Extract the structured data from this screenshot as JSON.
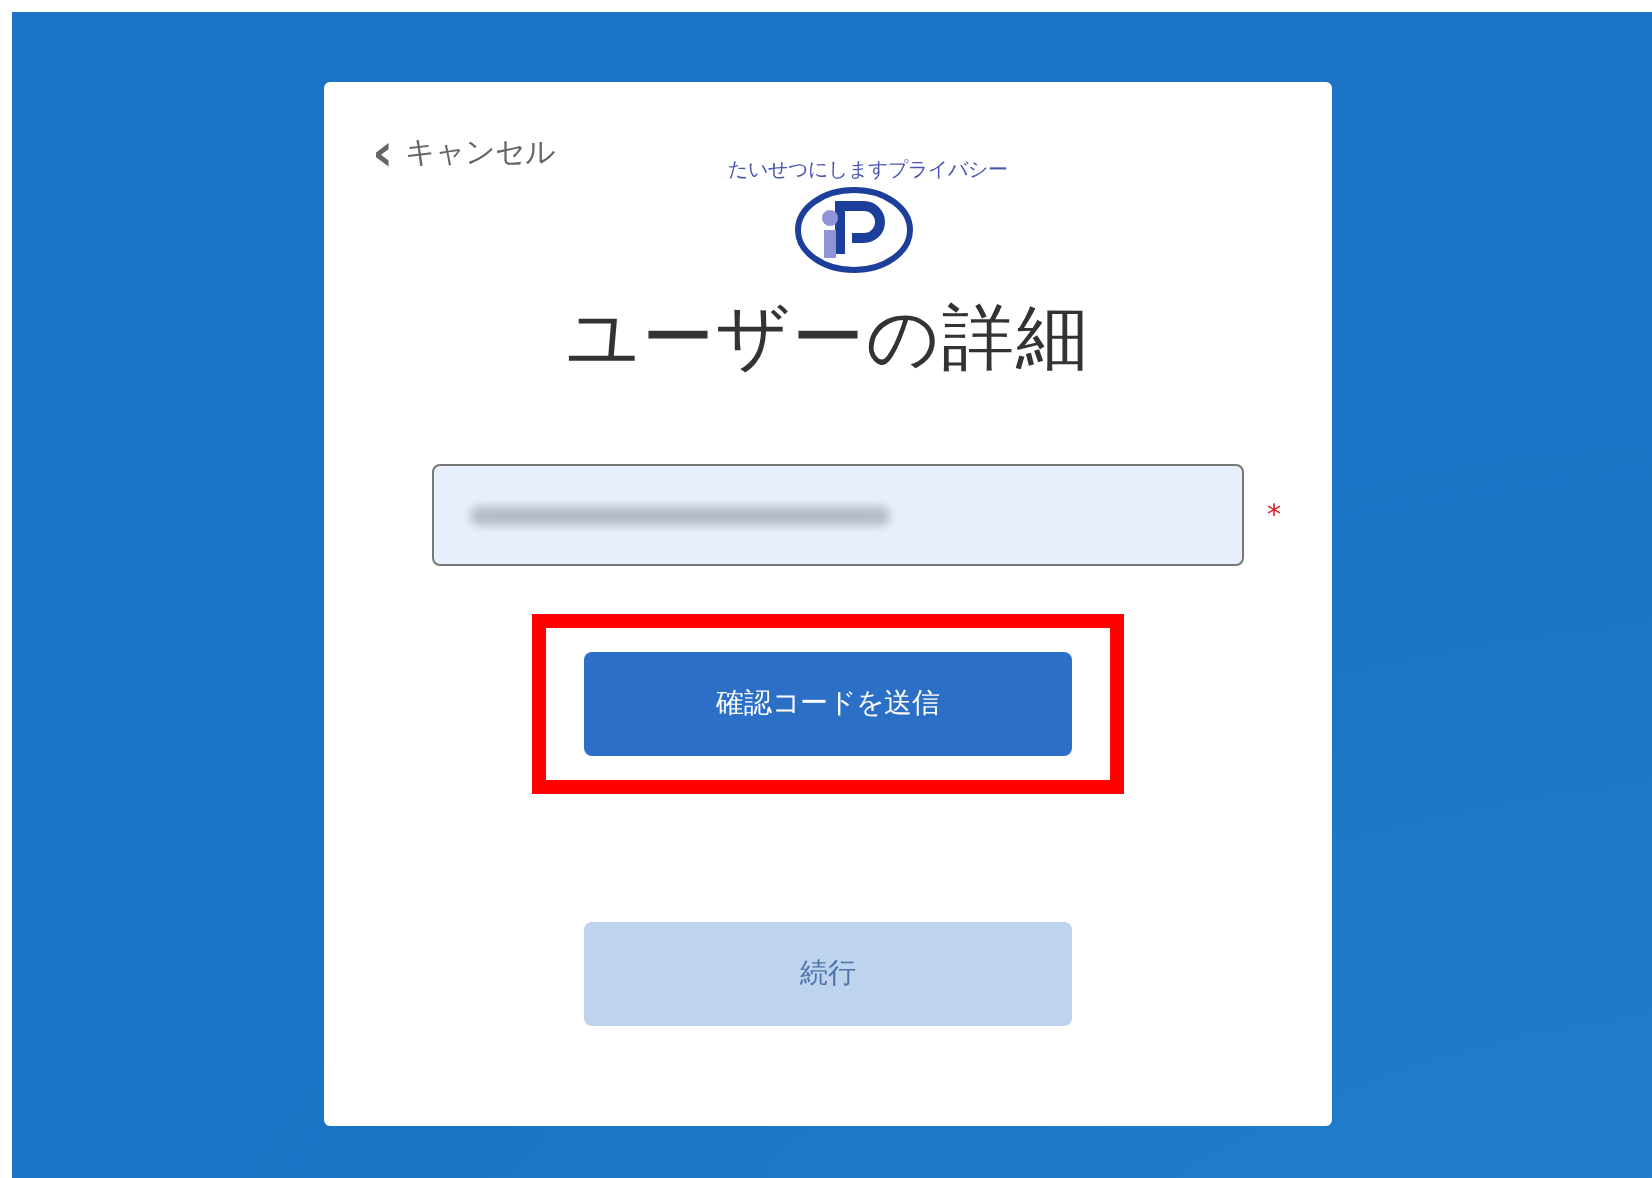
{
  "cancel_link": {
    "icon": "‹",
    "label": "キャンセル"
  },
  "logo": {
    "arc_text": "たいせつにしますプライバシー"
  },
  "title": "ユーザーの詳細",
  "email_field": {
    "required_mark": "*",
    "redacted": true
  },
  "buttons": [
    {
      "label": "確認コードを送信",
      "disabled": false,
      "highlighted": true
    },
    {
      "label": "続行",
      "disabled": true,
      "highlighted": false
    }
  ]
}
